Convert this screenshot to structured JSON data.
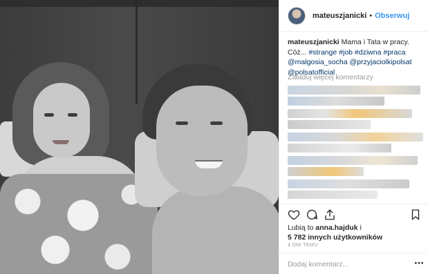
{
  "post": {
    "username": "mateuszjanicki",
    "separator": "•",
    "follow_label": "Obserwuj"
  },
  "caption": {
    "username": "mateuszjanicki",
    "text": " Mama i Tata w pracy. Cóż... ",
    "tags": [
      "#strange",
      "#job",
      "#dziwna",
      "#praca"
    ],
    "mentions": [
      "@malgosia_socha",
      "@przyjaciolkipolsat",
      "@polsatofficial"
    ]
  },
  "load_more_label": "Załaduj więcej komentarzy",
  "likes": {
    "prefix": "Lubią to",
    "user": "anna.hajduk",
    "conjunction": "i",
    "others": "5 782 innych użytkowników"
  },
  "timestamp": "4 DNI TEMU",
  "comment_box": {
    "placeholder": "Dodaj komentarz..."
  },
  "icons": {
    "like": "heart-icon",
    "comment": "comment-icon",
    "share": "share-icon",
    "save": "bookmark-icon",
    "more": "more-dots-icon"
  },
  "colors": {
    "link_blue": "#3897f0",
    "hashtag": "#003569",
    "muted": "#999999",
    "border": "#efefef"
  }
}
